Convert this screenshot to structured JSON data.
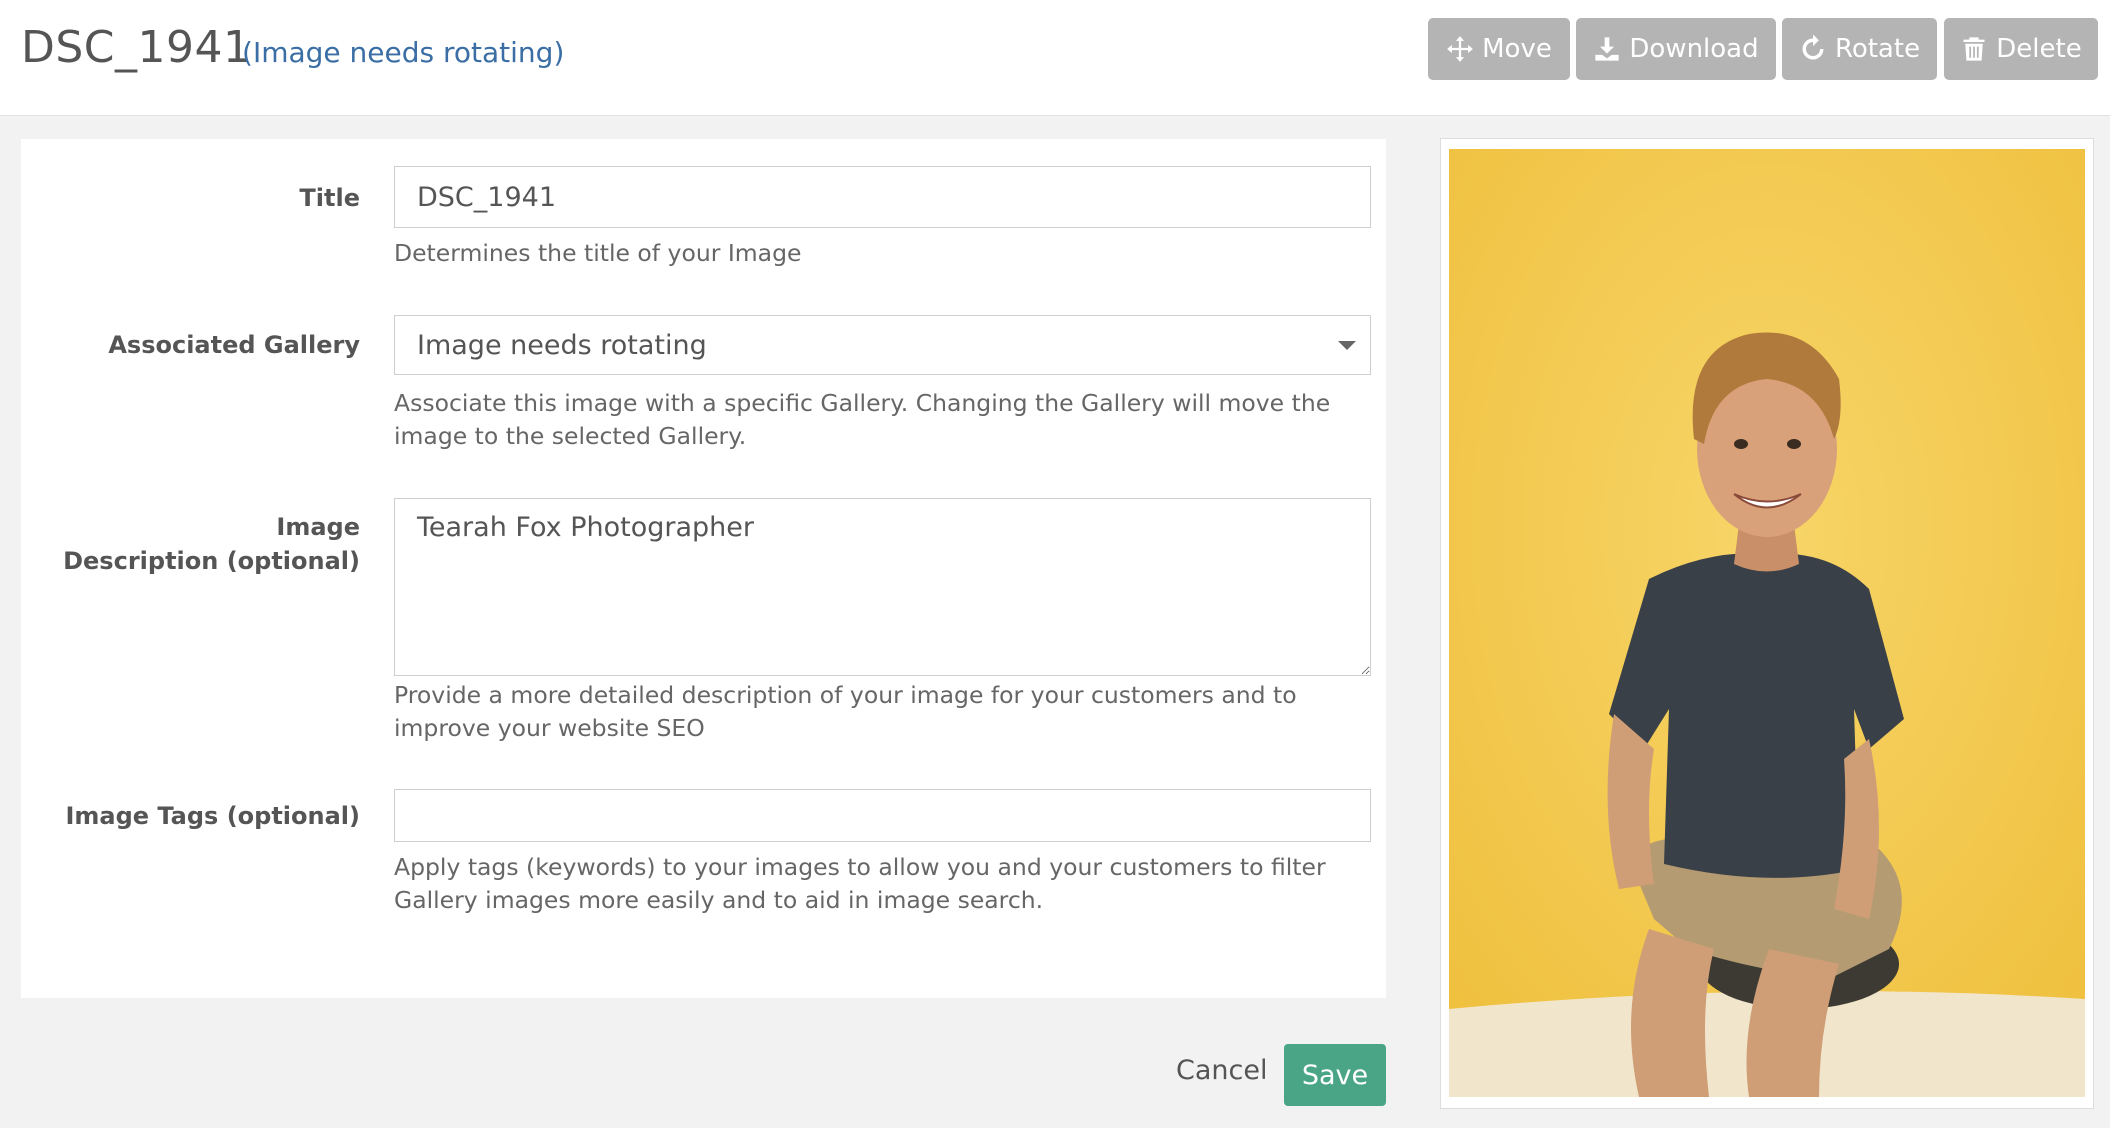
{
  "header": {
    "title": "DSC_1941",
    "gallery_open_paren": "(",
    "gallery_link": "Image needs rotating",
    "gallery_close_paren": ")"
  },
  "toolbar": {
    "move_label": "Move",
    "download_label": "Download",
    "rotate_label": "Rotate",
    "delete_label": "Delete",
    "move_icon": "arrows-move-icon",
    "download_icon": "download-icon",
    "rotate_icon": "rotate-icon",
    "delete_icon": "trash-icon",
    "button_color": "#b4b4b4"
  },
  "form": {
    "title": {
      "label": "Title",
      "value": "DSC_1941",
      "help": "Determines the title of your Image"
    },
    "gallery": {
      "label": "Associated Gallery",
      "selected": "Image needs rotating",
      "help": "Associate this image with a specific Gallery. Changing the Gallery will move the image to the selected Gallery."
    },
    "description": {
      "label_line1": "Image",
      "label_line2": "Description (optional)",
      "value": "Tearah Fox Photographer",
      "help": "Provide a more detailed description of your image for your customers and to improve your website SEO"
    },
    "tags": {
      "label": "Image Tags (optional)",
      "value": "",
      "help": "Apply tags (keywords) to your images to allow you and your customers to filter Gallery images more easily and to aid in image search."
    }
  },
  "actions": {
    "cancel_label": "Cancel",
    "save_label": "Save",
    "save_color": "#4aa586"
  },
  "preview": {
    "background_color": "#f3c94e"
  }
}
